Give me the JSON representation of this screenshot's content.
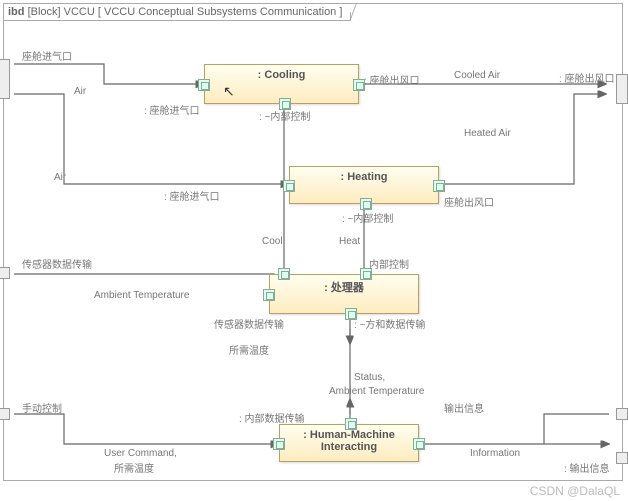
{
  "frame": {
    "prefix": "ibd",
    "stereotype": "[Block]",
    "name": "VCCU",
    "title": "VCCU Conceptual Subsystems Communication"
  },
  "blocks": {
    "cooling": {
      "label": ": Cooling"
    },
    "heating": {
      "label": ": Heating"
    },
    "processor": {
      "label": ": 处理器"
    },
    "hmi": {
      "label1": ": Human-Machine",
      "label2": "Interacting"
    }
  },
  "labels": {
    "l_top_port_in": "座舱进气口",
    "l_air1": "Air",
    "l_air2": "Air",
    "l_cool_in": ": 座舱进气口",
    "l_cool_out": ": 座舱出风口",
    "l_cooled_air": "Cooled Air",
    "l_top_port_out": ": 座舱出风口",
    "l_inner_ctrl1": ": ~内部控制",
    "l_heat_in": ": 座舱进气口",
    "l_heated_air": "Heated Air",
    "l_heat_out": "座舱出风口",
    "l_inner_ctrl2": ": ~内部控制",
    "l_cool": "Cool",
    "l_heat": "Heat",
    "l_inner_ctrl3": "内部控制",
    "l_sensor_port": "传感器数据传输",
    "l_ambient": "Ambient Temperature",
    "l_proc_sensor": "传感器数据传输",
    "l_indoor_temp": "所需温度",
    "l_ctrl_data": ": ~方和数据传输",
    "l_status": "Status,",
    "l_status2": "Ambient Temperature",
    "l_inner_ctrl4": ": 内部数据传输",
    "l_manual": "手动控制",
    "l_user_cmd": "User Command,",
    "l_user_cmd2": "所需温度",
    "l_out_info": "输出信息",
    "l_information": "Information",
    "l_out_info2": ": 输出信息"
  },
  "watermark": "CSDN @DalaQL"
}
